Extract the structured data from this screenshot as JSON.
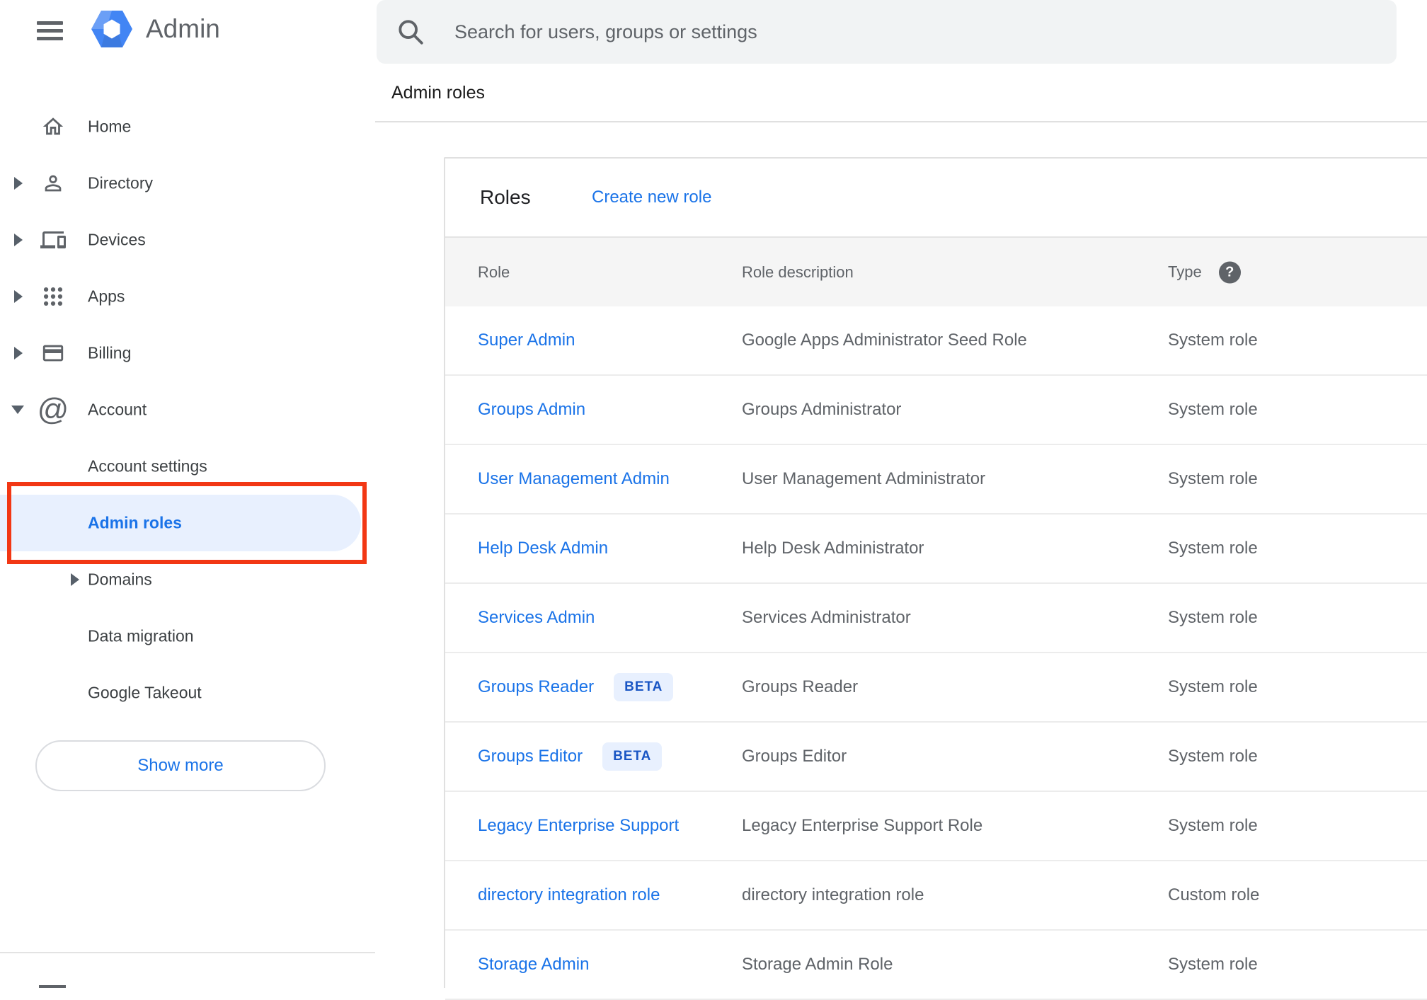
{
  "app": {
    "title": "Admin"
  },
  "search": {
    "placeholder": "Search for users, groups or settings"
  },
  "breadcrumb": {
    "label": "Admin roles"
  },
  "sidebar": {
    "items": [
      {
        "label": "Home"
      },
      {
        "label": "Directory"
      },
      {
        "label": "Devices"
      },
      {
        "label": "Apps"
      },
      {
        "label": "Billing"
      },
      {
        "label": "Account"
      },
      {
        "label": "Account settings"
      },
      {
        "label": "Admin roles"
      },
      {
        "label": "Domains"
      },
      {
        "label": "Data migration"
      },
      {
        "label": "Google Takeout"
      }
    ],
    "account_icon_glyph": "@",
    "show_more_label": "Show more"
  },
  "main": {
    "panel_title": "Roles",
    "create_link": "Create new role",
    "beta_label": "BETA",
    "table": {
      "headers": {
        "role": "Role",
        "description": "Role description",
        "type": "Type"
      },
      "type_help_icon": "?",
      "rows": [
        {
          "role": "Super Admin",
          "description": "Google Apps Administrator Seed Role",
          "type": "System role"
        },
        {
          "role": "Groups Admin",
          "description": "Groups Administrator",
          "type": "System role"
        },
        {
          "role": "User Management Admin",
          "description": "User Management Administrator",
          "type": "System role"
        },
        {
          "role": "Help Desk Admin",
          "description": "Help Desk Administrator",
          "type": "System role"
        },
        {
          "role": "Services Admin",
          "description": "Services Administrator",
          "type": "System role"
        },
        {
          "role": "Groups Reader",
          "description": "Groups Reader",
          "type": "System role"
        },
        {
          "role": "Groups Editor",
          "description": "Groups Editor",
          "type": "System role"
        },
        {
          "role": "Legacy Enterprise Support",
          "description": "Legacy Enterprise Support Role",
          "type": "System role"
        },
        {
          "role": "directory integration role",
          "description": "directory integration role",
          "type": "Custom role"
        },
        {
          "role": "Storage Admin",
          "description": "Storage Admin Role",
          "type": "System role"
        }
      ]
    }
  },
  "colors": {
    "link_blue": "#1a73e8",
    "selected_item_bg": "#e8f0fe",
    "annotation_red": "#f23714",
    "beta_badge_bg": "#e8f0fe",
    "beta_badge_text": "#1a56c4",
    "logo_blue": "#4285f4",
    "icon_gray": "#5f6368"
  }
}
